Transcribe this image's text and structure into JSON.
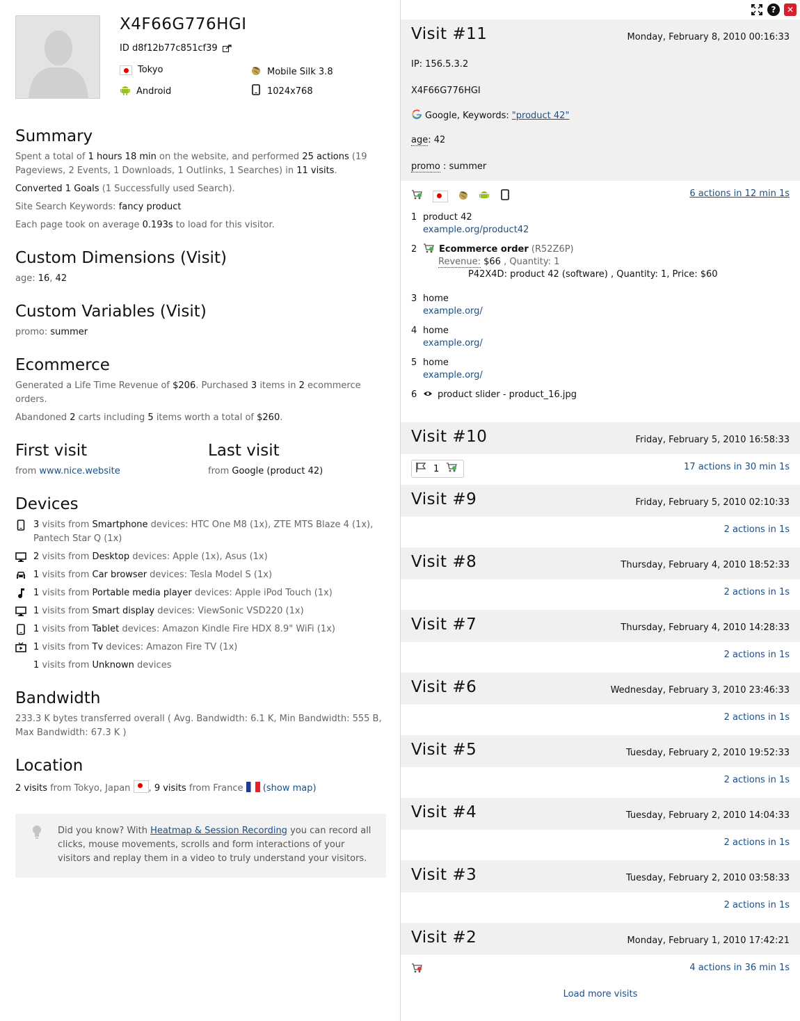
{
  "visitor": {
    "title": "X4F66G776HGI",
    "id_label": "ID d8f12b77c851cf39",
    "city": "Tokyo",
    "browser": "Mobile Silk 3.8",
    "os": "Android",
    "resolution": "1024x768"
  },
  "summary": {
    "heading": "Summary",
    "p1_a": "Spent a total of ",
    "p1_time": "1 hours 18 min",
    "p1_b": " on the website, and performed ",
    "p1_actions": "25 actions",
    "p1_c": " (19 Pageviews, 2 Events, 1 Downloads, 1 Outlinks, 1 Searches) in ",
    "p1_visits": "11 visits",
    "p1_d": ".",
    "p2_a": "Converted 1 Goals",
    "p2_b": " (1 Successfully used Search).",
    "p3_a": "Site Search Keywords: ",
    "p3_kw": "fancy product",
    "p4_a": "Each page took on average ",
    "p4_v": "0.193s",
    "p4_b": " to load for this visitor."
  },
  "custom_dimensions": {
    "heading": "Custom Dimensions (Visit)",
    "label": "age: ",
    "v1": "16",
    "sep": ", ",
    "v2": "42"
  },
  "custom_variables": {
    "heading": "Custom Variables (Visit)",
    "label": "promo: ",
    "value": "summer"
  },
  "ecommerce": {
    "heading": "Ecommerce",
    "p1_a": "Generated a Life Time Revenue of ",
    "p1_rev": "$206",
    "p1_b": ". Purchased ",
    "p1_items": "3",
    "p1_c": " items in ",
    "p1_orders": "2",
    "p1_d": " ecommerce orders.",
    "p2_a": "Abandoned ",
    "p2_carts": "2",
    "p2_b": " carts including ",
    "p2_items": "5",
    "p2_c": " items worth a total of ",
    "p2_total": "$260",
    "p2_d": "."
  },
  "first_visit": {
    "heading": "First visit",
    "from": "from ",
    "value": "www.nice.website"
  },
  "last_visit": {
    "heading": "Last visit",
    "from": "from ",
    "value": "Google (product 42)"
  },
  "devices": {
    "heading": "Devices",
    "rows": [
      {
        "count": "3",
        "mid": " visits from ",
        "type": "Smartphone",
        "rest": " devices: HTC One M8 (1x), ZTE MTS Blaze 4 (1x), Pantech Star Q (1x)"
      },
      {
        "count": "2",
        "mid": " visits from ",
        "type": "Desktop",
        "rest": " devices: Apple (1x), Asus (1x)"
      },
      {
        "count": "1",
        "mid": " visits from ",
        "type": "Car browser",
        "rest": " devices: Tesla Model S (1x)"
      },
      {
        "count": "1",
        "mid": " visits from ",
        "type": "Portable media player",
        "rest": " devices: Apple iPod Touch (1x)"
      },
      {
        "count": "1",
        "mid": " visits from ",
        "type": "Smart display",
        "rest": " devices: ViewSonic VSD220 (1x)"
      },
      {
        "count": "1",
        "mid": " visits from ",
        "type": "Tablet",
        "rest": " devices: Amazon Kindle Fire HDX 8.9\" WiFi (1x)"
      },
      {
        "count": "1",
        "mid": " visits from ",
        "type": "Tv",
        "rest": " devices: Amazon Fire TV (1x)"
      },
      {
        "count": "1",
        "mid": " visits from ",
        "type": "Unknown",
        "rest": " devices"
      }
    ]
  },
  "bandwidth": {
    "heading": "Bandwidth",
    "text": "233.3 K bytes transferred overall ( Avg. Bandwidth: 6.1 K, Min Bandwidth: 555 B, Max Bandwidth: 67.3 K )"
  },
  "location": {
    "heading": "Location",
    "v1": "2 visits",
    "t1": " from Tokyo, Japan ",
    "sep": ", ",
    "v2": "9 visits",
    "t2": " from France ",
    "map": "(show map)"
  },
  "tip": {
    "a": "Did you know? With ",
    "link": "Heatmap & Session Recording",
    "b": " you can record all clicks, mouse movements, scrolls and form interactions of your visitors and replay them in a video to truly understand your visitors."
  },
  "visit11": {
    "title": "Visit #11",
    "date": "Monday, February 8, 2010 00:16:33",
    "ip": "IP: 156.5.3.2",
    "visitor": "X4F66G776HGI",
    "ref_a": "Google, Keywords: ",
    "ref_kw": "\"product 42\"",
    "age_label": "age",
    "age_value": ": 42",
    "promo_label": "promo",
    "promo_value": " : summer",
    "summary": "6 actions in 12 min 1s",
    "actions": [
      {
        "n": "1",
        "title": "product 42",
        "url": "example.org/product42"
      },
      {
        "n": "2",
        "title": "Ecommerce order",
        "sub": " (R52Z6P)",
        "rev_label": "Revenue:",
        "rev": " $66",
        "qty": " , Quantity: 1",
        "item": "P42X4D: product 42 (software) , Quantity: 1, Price: $60"
      },
      {
        "n": "3",
        "title": "home",
        "url": "example.org/"
      },
      {
        "n": "4",
        "title": "home",
        "url": "example.org/"
      },
      {
        "n": "5",
        "title": "home",
        "url": "example.org/"
      },
      {
        "n": "6",
        "title": "product slider - product_16.jpg"
      }
    ]
  },
  "visits": [
    {
      "title": "Visit #10",
      "date": "Friday, February 5, 2010 16:58:33",
      "summary": "17 actions in 30 min 1s",
      "goal_count": "1"
    },
    {
      "title": "Visit #9",
      "date": "Friday, February 5, 2010 02:10:33",
      "summary": "2 actions in 1s"
    },
    {
      "title": "Visit #8",
      "date": "Thursday, February 4, 2010 18:52:33",
      "summary": "2 actions in 1s"
    },
    {
      "title": "Visit #7",
      "date": "Thursday, February 4, 2010 14:28:33",
      "summary": "2 actions in 1s"
    },
    {
      "title": "Visit #6",
      "date": "Wednesday, February 3, 2010 23:46:33",
      "summary": "2 actions in 1s"
    },
    {
      "title": "Visit #5",
      "date": "Tuesday, February 2, 2010 19:52:33",
      "summary": "2 actions in 1s"
    },
    {
      "title": "Visit #4",
      "date": "Tuesday, February 2, 2010 14:04:33",
      "summary": "2 actions in 1s"
    },
    {
      "title": "Visit #3",
      "date": "Tuesday, February 2, 2010 03:58:33",
      "summary": "2 actions in 1s"
    },
    {
      "title": "Visit #2",
      "date": "Monday, February 1, 2010 17:42:21",
      "summary": "4 actions in 36 min 1s"
    }
  ],
  "load_more": "Load more visits",
  "colors": {
    "link": "#1a4f86",
    "header_bg": "#f0f0f0",
    "close": "#d4212b",
    "android": "#97c024"
  }
}
